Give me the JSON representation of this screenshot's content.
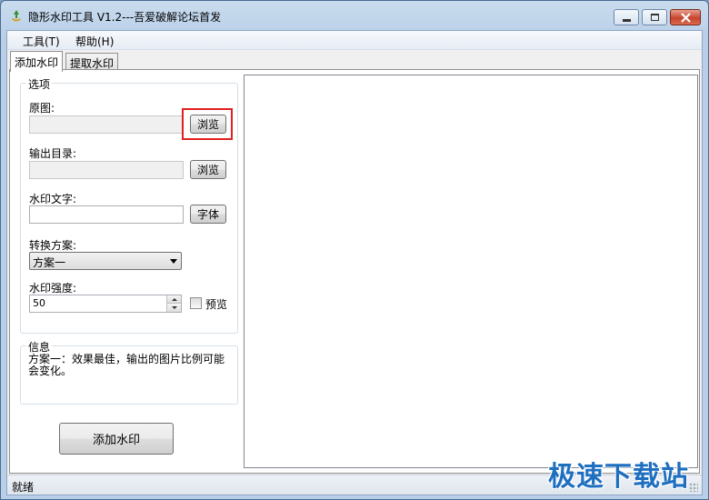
{
  "window": {
    "title": "隐形水印工具 V1.2---吾爱破解论坛首发"
  },
  "menu": {
    "items": [
      {
        "label": "工具(T)"
      },
      {
        "label": "帮助(H)"
      }
    ]
  },
  "tabs": [
    {
      "label": "添加水印",
      "active": true
    },
    {
      "label": "提取水印",
      "active": false
    }
  ],
  "options": {
    "legend": "选项",
    "source_label": "原图:",
    "source_value": "",
    "browse_label": "浏览",
    "output_label": "输出目录:",
    "output_value": "",
    "output_browse_label": "浏览",
    "text_label": "水印文字:",
    "text_value": "",
    "font_label": "字体",
    "scheme_label": "转换方案:",
    "scheme_value": "方案一",
    "strength_label": "水印强度:",
    "strength_value": "50",
    "preview_label": "预览",
    "preview_checked": false
  },
  "info": {
    "legend": "信息",
    "text": "方案一：效果最佳，输出的图片比例可能会变化。"
  },
  "actions": {
    "add_watermark_label": "添加水印"
  },
  "status": {
    "text": "就绪"
  },
  "site_watermark": "极速下载站",
  "colors": {
    "highlight": "#e02020",
    "site_watermark": "#1f6fc0"
  }
}
